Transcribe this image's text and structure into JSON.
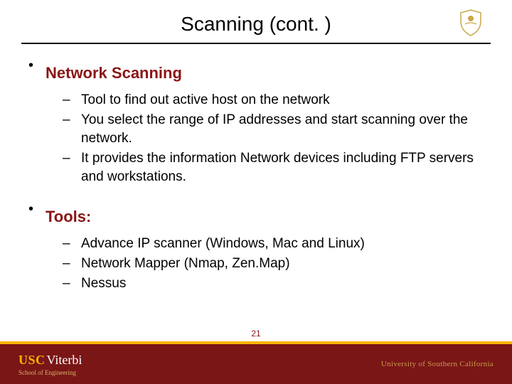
{
  "slide": {
    "title": "Scanning (cont. )",
    "page_number": "21"
  },
  "sections": [
    {
      "heading": "Network Scanning",
      "items": [
        "Tool to find out active host on the network",
        "You select the range of IP addresses and start scanning over the network.",
        "It provides the information Network devices including FTP servers and workstations."
      ]
    },
    {
      "heading": "Tools:",
      "items": [
        "Advance IP scanner (Windows, Mac and Linux)",
        "Network Mapper (Nmap, Zen.Map)",
        "Nessus"
      ]
    }
  ],
  "footer": {
    "usc": "USC",
    "viterbi": "Viterbi",
    "school": "School of Engineering",
    "university": "University of Southern California"
  }
}
